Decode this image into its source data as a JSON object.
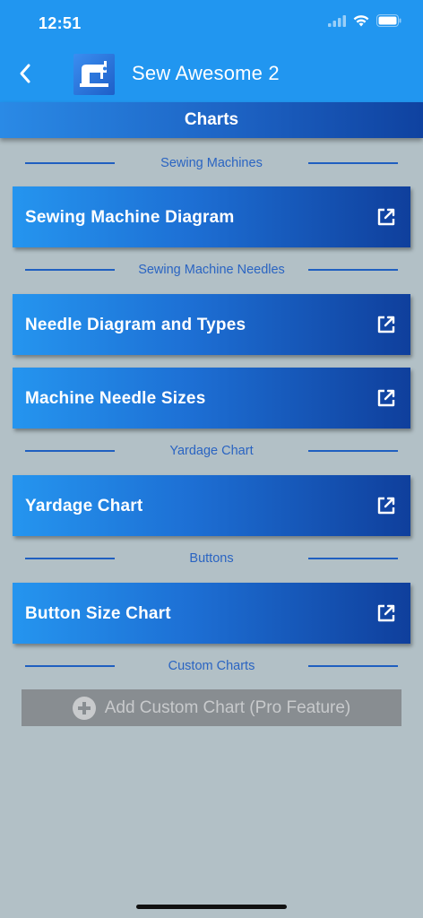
{
  "status_bar": {
    "time": "12:51"
  },
  "nav": {
    "title": "Sew Awesome 2"
  },
  "subheader": {
    "title": "Charts"
  },
  "sections": [
    {
      "label": "Sewing Machines"
    },
    {
      "label": "Sewing Machine Needles"
    },
    {
      "label": "Yardage Chart"
    },
    {
      "label": "Buttons"
    },
    {
      "label": "Custom Charts"
    }
  ],
  "charts": [
    {
      "label": "Sewing Machine Diagram",
      "icon": "open-external-icon"
    },
    {
      "label": "Needle Diagram and Types",
      "icon": "open-external-icon"
    },
    {
      "label": "Machine Needle Sizes",
      "icon": "open-external-icon"
    },
    {
      "label": "Yardage Chart",
      "icon": "open-external-icon"
    },
    {
      "label": "Button Size Chart",
      "icon": "open-external-icon"
    }
  ],
  "add_custom": {
    "label": "Add Custom Chart (Pro Feature)",
    "icon": "plus-circle-icon"
  },
  "colors": {
    "topbar": "#2196f0",
    "background": "#b2c0c6",
    "accent": "#2a64c2",
    "disabled_button": "#888d91"
  }
}
